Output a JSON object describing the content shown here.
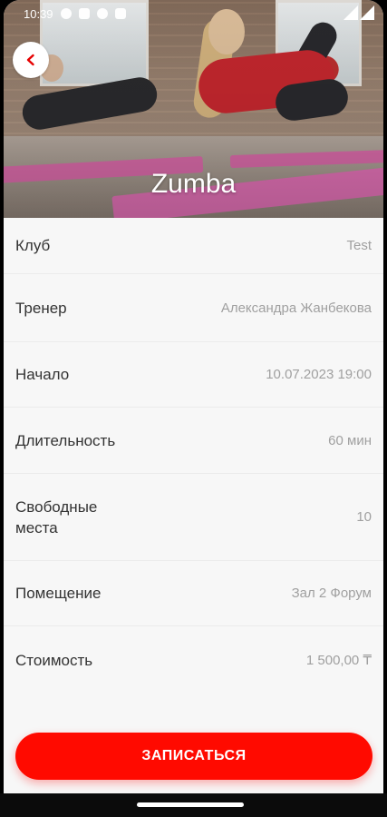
{
  "status_bar": {
    "time": "10:39"
  },
  "hero": {
    "title": "Zumba"
  },
  "details": [
    {
      "label": "Клуб",
      "value": "Test"
    },
    {
      "label": "Тренер",
      "value": "Александра Жанбекова"
    },
    {
      "label": "Начало",
      "value": "10.07.2023 19:00"
    },
    {
      "label": "Длительность",
      "value": "60 мин"
    },
    {
      "label": "Свободные места",
      "value": "10"
    },
    {
      "label": "Помещение",
      "value": "Зал 2 Форум"
    },
    {
      "label": "Стоимость",
      "value": "1 500,00 ₸"
    }
  ],
  "actions": {
    "book_label": "ЗАПИСАТЬСЯ"
  },
  "colors": {
    "accent": "#ff0a00",
    "label": "#333333",
    "value": "#a0a0a0"
  }
}
